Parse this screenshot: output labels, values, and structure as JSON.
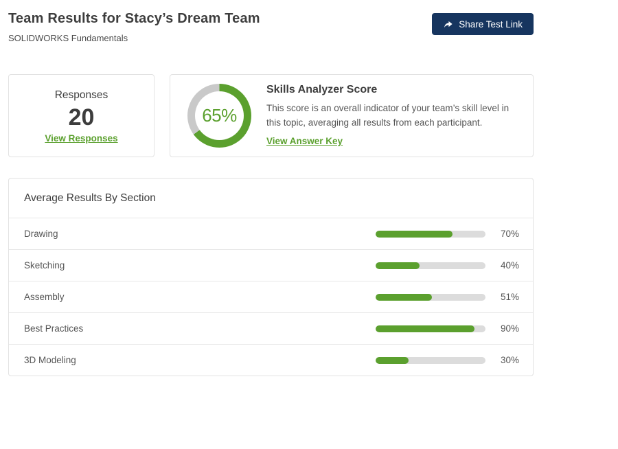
{
  "header": {
    "title": "Team Results for Stacy’s Dream Team",
    "subtitle": "SOLIDWORKS Fundamentals",
    "share_button_label": "Share Test Link"
  },
  "responses_card": {
    "title": "Responses",
    "count": "20",
    "link": "View Responses"
  },
  "score_card": {
    "title": "Skills Analyzer Score",
    "description": "This score is an overall indicator of your team’s skill level in this topic, averaging all results from each participant.",
    "link": "View Answer Key",
    "score_label": "65%",
    "score_percent": 65
  },
  "sections_card": {
    "title": "Average Results By Section"
  },
  "chart_data": {
    "type": "bar",
    "title": "Average Results By Section",
    "categories": [
      "Drawing",
      "Sketching",
      "Assembly",
      "Best Practices",
      "3D Modeling"
    ],
    "values": [
      70,
      40,
      51,
      90,
      30
    ],
    "value_labels": [
      "70%",
      "40%",
      "51%",
      "90%",
      "30%"
    ],
    "xlim": [
      0,
      100
    ],
    "donut": {
      "label": "Skills Analyzer Score",
      "value": 65,
      "max": 100
    }
  },
  "colors": {
    "green": "#5ba02e",
    "navy": "#16355f",
    "bar_track": "#dcdcdc",
    "donut_track": "#c9c9c9",
    "card_border": "#e2e2e2"
  }
}
